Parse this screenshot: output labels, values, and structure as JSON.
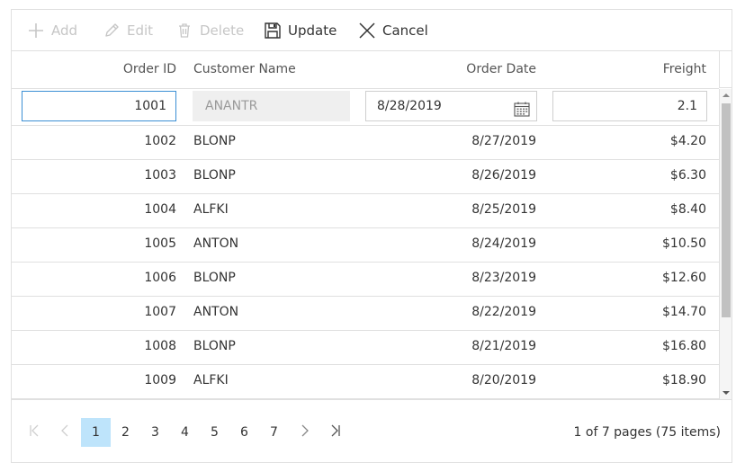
{
  "toolbar": {
    "add_label": "Add",
    "edit_label": "Edit",
    "delete_label": "Delete",
    "update_label": "Update",
    "cancel_label": "Cancel"
  },
  "columns": {
    "order_id": "Order ID",
    "customer_name": "Customer Name",
    "order_date": "Order Date",
    "freight": "Freight"
  },
  "edit_row": {
    "order_id": "1001",
    "customer_name": "ANANTR",
    "order_date": "8/28/2019",
    "freight": "2.1"
  },
  "rows": [
    {
      "order_id": "1002",
      "customer": "BLONP",
      "date": "8/27/2019",
      "freight": "$4.20"
    },
    {
      "order_id": "1003",
      "customer": "BLONP",
      "date": "8/26/2019",
      "freight": "$6.30"
    },
    {
      "order_id": "1004",
      "customer": "ALFKI",
      "date": "8/25/2019",
      "freight": "$8.40"
    },
    {
      "order_id": "1005",
      "customer": "ANTON",
      "date": "8/24/2019",
      "freight": "$10.50"
    },
    {
      "order_id": "1006",
      "customer": "BLONP",
      "date": "8/23/2019",
      "freight": "$12.60"
    },
    {
      "order_id": "1007",
      "customer": "ANTON",
      "date": "8/22/2019",
      "freight": "$14.70"
    },
    {
      "order_id": "1008",
      "customer": "BLONP",
      "date": "8/21/2019",
      "freight": "$16.80"
    },
    {
      "order_id": "1009",
      "customer": "ALFKI",
      "date": "8/20/2019",
      "freight": "$18.90"
    }
  ],
  "pager": {
    "pages": [
      "1",
      "2",
      "3",
      "4",
      "5",
      "6",
      "7"
    ],
    "current_page": "1",
    "info": "1 of 7 pages (75 items)"
  },
  "colors": {
    "active_page_bg": "#bee4fb",
    "focus_border": "#3c8fd4",
    "disabled_text": "#c6c6c6",
    "border": "#e0e0e0"
  },
  "icons": {
    "add": "plus-icon",
    "edit": "pencil-icon",
    "delete": "trash-icon",
    "update": "save-icon",
    "cancel": "close-icon",
    "calendar": "calendar-icon"
  }
}
